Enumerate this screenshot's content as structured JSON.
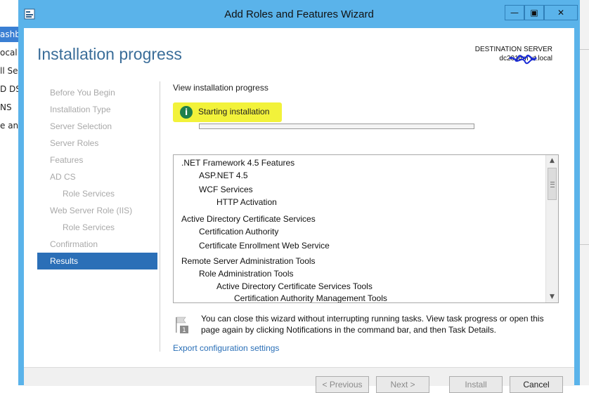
{
  "background_sidebar": {
    "items": [
      {
        "label": "ashb",
        "active": true
      },
      {
        "label": "ocal S",
        "active": false
      },
      {
        "label": "ll Ser",
        "active": false
      },
      {
        "label": "D DS",
        "active": false
      },
      {
        "label": "NS",
        "active": false
      },
      {
        "label": "e an",
        "active": false
      }
    ]
  },
  "window": {
    "title": "Add Roles and Features Wizard",
    "controls": {
      "minimize": "—",
      "maximize": "▣",
      "close": "✕"
    }
  },
  "header": {
    "page_title": "Installation progress",
    "destination_label": "DESTINATION SERVER",
    "destination_server": "dc2014m      ut.local"
  },
  "nav": {
    "items": [
      {
        "label": "Before You Begin",
        "sub": false,
        "active": false
      },
      {
        "label": "Installation Type",
        "sub": false,
        "active": false
      },
      {
        "label": "Server Selection",
        "sub": false,
        "active": false
      },
      {
        "label": "Server Roles",
        "sub": false,
        "active": false
      },
      {
        "label": "Features",
        "sub": false,
        "active": false
      },
      {
        "label": "AD CS",
        "sub": false,
        "active": false
      },
      {
        "label": "Role Services",
        "sub": true,
        "active": false
      },
      {
        "label": "Web Server Role (IIS)",
        "sub": false,
        "active": false
      },
      {
        "label": "Role Services",
        "sub": true,
        "active": false
      },
      {
        "label": "Confirmation",
        "sub": false,
        "active": false
      },
      {
        "label": "Results",
        "sub": false,
        "active": true
      }
    ]
  },
  "main": {
    "heading": "View installation progress",
    "status_icon": "info-icon",
    "status_text": "Starting installation",
    "progress_fraction": 0.0,
    "highlight_color": "#f2f23a",
    "features": [
      {
        "label": ".NET Framework 4.5 Features",
        "level": 0
      },
      {
        "label": "ASP.NET 4.5",
        "level": 1
      },
      {
        "label": "WCF Services",
        "level": 1
      },
      {
        "label": "HTTP Activation",
        "level": 2
      },
      {
        "label": "Active Directory Certificate Services",
        "level": 0
      },
      {
        "label": "Certification Authority",
        "level": 1
      },
      {
        "label": "Certificate Enrollment Web Service",
        "level": 1
      },
      {
        "label": "Remote Server Administration Tools",
        "level": 0
      },
      {
        "label": "Role Administration Tools",
        "level": 1
      },
      {
        "label": "Active Directory Certificate Services Tools",
        "level": 2
      },
      {
        "label": "Certification Authority Management Tools",
        "level": 3
      }
    ],
    "notice": "You can close this wizard without interrupting running tasks. View task progress or open this page again by clicking Notifications in the command bar, and then Task Details.",
    "notice_icon": "flag-icon",
    "export_link": "Export configuration settings"
  },
  "footer": {
    "previous": "< Previous",
    "next": "Next >",
    "install": "Install",
    "cancel": "Cancel"
  },
  "colors": {
    "title_bar": "#5ab3ea",
    "title_text": "#3a6d99",
    "nav_active": "#2b6fb7",
    "link": "#2a6fb7"
  }
}
